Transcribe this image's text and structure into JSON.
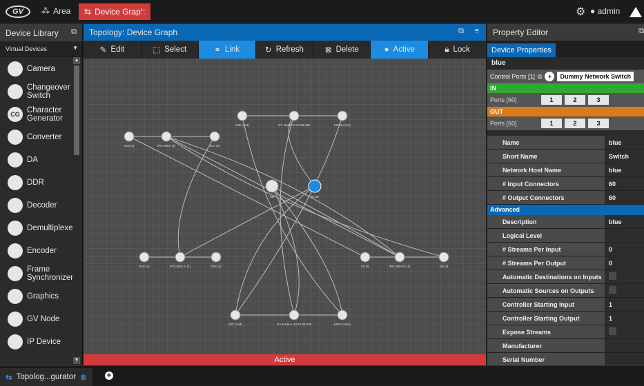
{
  "topbar": {
    "area_label": "Area",
    "active_tab_label": "Device Graph",
    "user_label": "admin"
  },
  "library": {
    "title": "Device Library",
    "filter": "Virtual Devices",
    "items": [
      {
        "label": "Camera",
        "icon": "camera-icon"
      },
      {
        "label": "Changeover Switch",
        "icon": "changeover-icon"
      },
      {
        "label": "Character Generator",
        "icon": "cg-icon",
        "glyph": "CG"
      },
      {
        "label": "Converter",
        "icon": "converter-icon"
      },
      {
        "label": "DA",
        "icon": "da-icon"
      },
      {
        "label": "DDR",
        "icon": "ddr-icon"
      },
      {
        "label": "Decoder",
        "icon": "decoder-icon"
      },
      {
        "label": "Demultiplexe",
        "icon": "demux-icon"
      },
      {
        "label": "Encoder",
        "icon": "encoder-icon"
      },
      {
        "label": "Frame Synchronizer",
        "icon": "frame-sync-icon"
      },
      {
        "label": "Graphics",
        "icon": "graphics-icon"
      },
      {
        "label": "GV Node",
        "icon": "gv-node-icon"
      },
      {
        "label": "IP Device",
        "icon": "ip-device-icon"
      }
    ]
  },
  "topology": {
    "title": "Topology: Device Graph",
    "toolbar": [
      {
        "label": "Edit",
        "icon": "pencil-icon",
        "active": false
      },
      {
        "label": "Select",
        "icon": "select-icon",
        "active": false
      },
      {
        "label": "Link",
        "icon": "link-icon",
        "active": true
      },
      {
        "label": "Refresh",
        "icon": "refresh-icon",
        "active": false
      },
      {
        "label": "Delete",
        "icon": "delete-icon",
        "active": false
      },
      {
        "label": "Active",
        "icon": "bulb-icon",
        "active": true
      },
      {
        "label": "Lock",
        "icon": "lock-icon",
        "active": false
      }
    ],
    "status": "Active",
    "nodes": [
      {
        "label": "S36 (144)"
      },
      {
        "label": "GV Node 10.37.80.238"
      },
      {
        "label": "MV36 (144)"
      },
      {
        "label": "S13 (3)"
      },
      {
        "label": "IPG-3901-(1)"
      },
      {
        "label": "D13 (3)"
      },
      {
        "label": "RD"
      },
      {
        "label": "BLUE"
      },
      {
        "label": "S2X (4)"
      },
      {
        "label": "IPG-3901-A (1)"
      },
      {
        "label": "D2X (4)"
      },
      {
        "label": "S9 (3)"
      },
      {
        "label": "IPG-3901-B (1)"
      },
      {
        "label": "D9 (3)"
      },
      {
        "label": "S37 (144)"
      },
      {
        "label": "GV Node-A 10.37.80.239"
      },
      {
        "label": "MV37 (144)"
      },
      {
        "label": "9646 (1)"
      },
      {
        "label": "9614 (1)"
      }
    ]
  },
  "property_editor": {
    "title": "Property Editor",
    "tab": "Device Properties",
    "device_name": "blue",
    "control_ports_label": "Control Ports [1]",
    "control_port_chip": "Dummy Network Switch",
    "in_label": "IN",
    "out_label": "OUT",
    "in_ports_label": "Ports [60]",
    "out_ports_label": "Ports [60]",
    "port_buttons": [
      "1",
      "2",
      "3"
    ],
    "properties": [
      {
        "key": "Name",
        "value": "blue"
      },
      {
        "key": "Short Name",
        "value": "Switch"
      },
      {
        "key": "Network Host Name",
        "value": "blue"
      },
      {
        "key": "# Input Connectors",
        "value": "60"
      },
      {
        "key": "# Output Connectors",
        "value": "60"
      }
    ],
    "advanced_label": "Advanced",
    "advanced": [
      {
        "key": "Description",
        "value": "blue"
      },
      {
        "key": "Logical Level",
        "value": ""
      },
      {
        "key": "# Streams Per Input",
        "value": "0"
      },
      {
        "key": "# Streams Per Output",
        "value": "0"
      },
      {
        "key": "Automatic Destinations on Inputs",
        "value": "",
        "checkbox": true
      },
      {
        "key": "Automatic Sources on Outputs",
        "value": "",
        "checkbox": true
      },
      {
        "key": "Controller Starting Input",
        "value": "1"
      },
      {
        "key": "Controller Starting Output",
        "value": "1"
      },
      {
        "key": "Expose Streams",
        "value": "",
        "checkbox": true
      },
      {
        "key": "Manufacturer",
        "value": ""
      },
      {
        "key": "Serial Number",
        "value": ""
      }
    ]
  },
  "bottom": {
    "tab_label": "Topolog...gurator"
  }
}
